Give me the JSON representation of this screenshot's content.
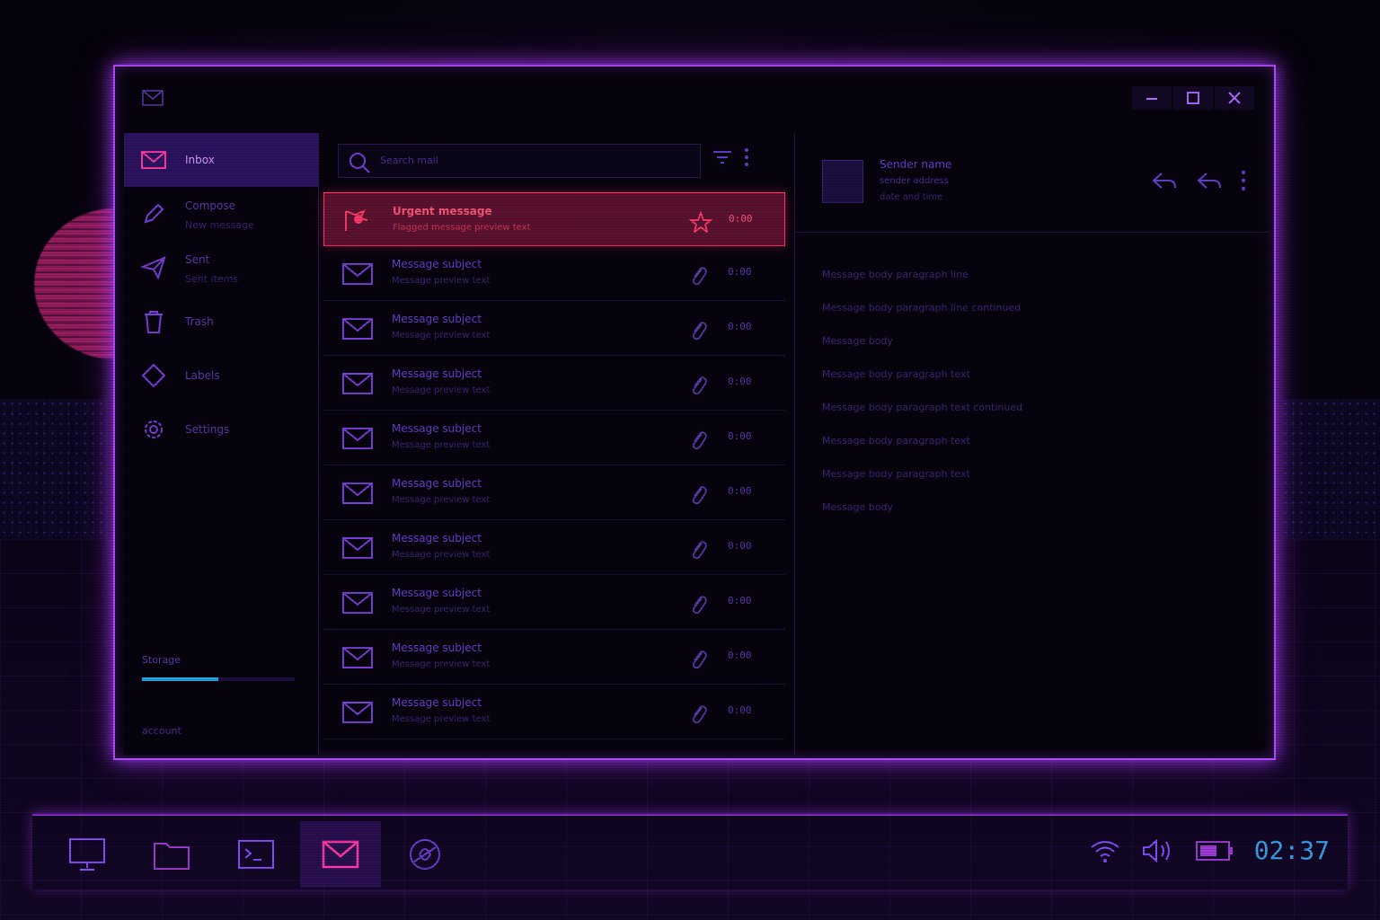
{
  "window": {
    "title": "",
    "controls": {
      "minimize": "minimize-icon",
      "maximize": "maximize-icon",
      "close": "close-icon"
    }
  },
  "sidebar": {
    "items": [
      {
        "icon": "inbox-icon",
        "label": "Inbox",
        "sub": ""
      },
      {
        "icon": "compose-icon",
        "label": "Compose",
        "sub": "New message"
      },
      {
        "icon": "send-icon",
        "label": "Sent",
        "sub": "Sent items"
      },
      {
        "icon": "trash-icon",
        "label": "Trash",
        "sub": ""
      },
      {
        "icon": "tag-icon",
        "label": "Labels",
        "sub": ""
      },
      {
        "icon": "settings-icon",
        "label": "Settings",
        "sub": ""
      }
    ],
    "storage": {
      "label": "Storage",
      "used_fraction": 0.5
    },
    "account": "account"
  },
  "search": {
    "placeholder": "Search mail"
  },
  "messages": [
    {
      "subject": "Urgent message",
      "preview": "Flagged message preview text",
      "time": "0:00",
      "flagged": true
    },
    {
      "subject": "Message subject",
      "preview": "Message preview text",
      "time": "0:00"
    },
    {
      "subject": "Message subject",
      "preview": "Message preview text",
      "time": "0:00"
    },
    {
      "subject": "Message subject",
      "preview": "Message preview text",
      "time": "0:00"
    },
    {
      "subject": "Message subject",
      "preview": "Message preview text",
      "time": "0:00"
    },
    {
      "subject": "Message subject",
      "preview": "Message preview text",
      "time": "0:00"
    },
    {
      "subject": "Message subject",
      "preview": "Message preview text",
      "time": "0:00"
    },
    {
      "subject": "Message subject",
      "preview": "Message preview text",
      "time": "0:00"
    },
    {
      "subject": "Message subject",
      "preview": "Message preview text",
      "time": "0:00"
    },
    {
      "subject": "Message subject",
      "preview": "Message preview text",
      "time": "0:00"
    }
  ],
  "reader": {
    "from": "Sender name",
    "address": "sender address",
    "date": "date and time",
    "body": [
      "Message body paragraph line",
      "Message body paragraph line continued",
      "Message body",
      "Message body paragraph text",
      "Message body paragraph text continued",
      "Message body paragraph text",
      "Message body paragraph text",
      "Message body"
    ]
  },
  "taskbar": {
    "apps": [
      "desktop-icon",
      "folder-icon",
      "terminal-icon",
      "mail-icon",
      "browser-icon"
    ],
    "active_index": 3,
    "clock": "02:37"
  },
  "colors": {
    "accent": "#b44bff",
    "selected": "#ff3a6a",
    "clock": "#3aa0e8"
  }
}
